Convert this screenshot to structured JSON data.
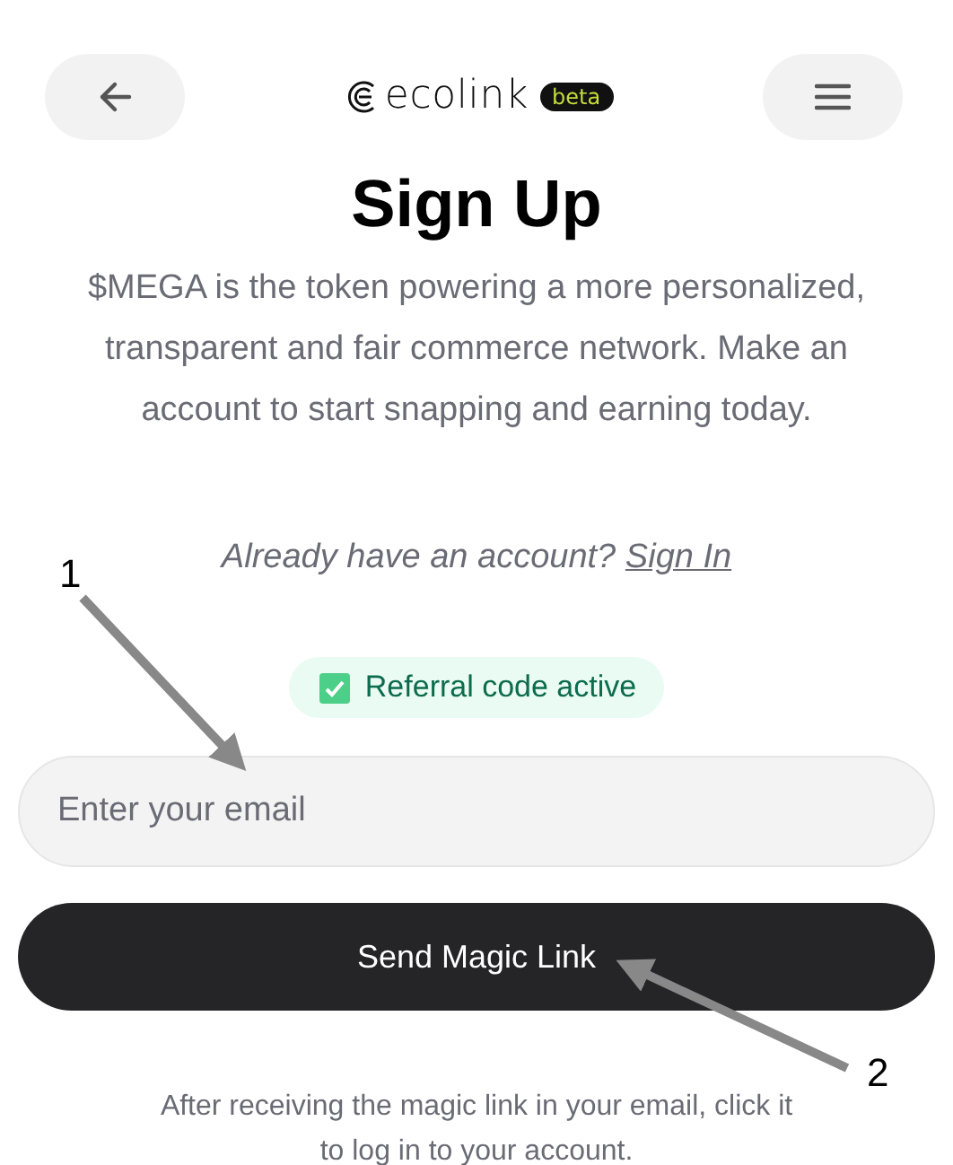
{
  "header": {
    "logo_text": "ecolink",
    "logo_badge": "beta"
  },
  "title": "Sign Up",
  "intro": "$MEGA is the token powering a more personalized, transparent and fair commerce network. Make an account to start snapping and earning today.",
  "signin": {
    "prompt": "Already have an account?",
    "link": "Sign In"
  },
  "referral": {
    "label": "Referral code active"
  },
  "email": {
    "placeholder": "Enter your email"
  },
  "submit": "Send Magic Link",
  "footnote": "After receiving the magic link in your email, click it to log in to your account.",
  "annotations": [
    {
      "label": "1"
    },
    {
      "label": "2"
    }
  ]
}
